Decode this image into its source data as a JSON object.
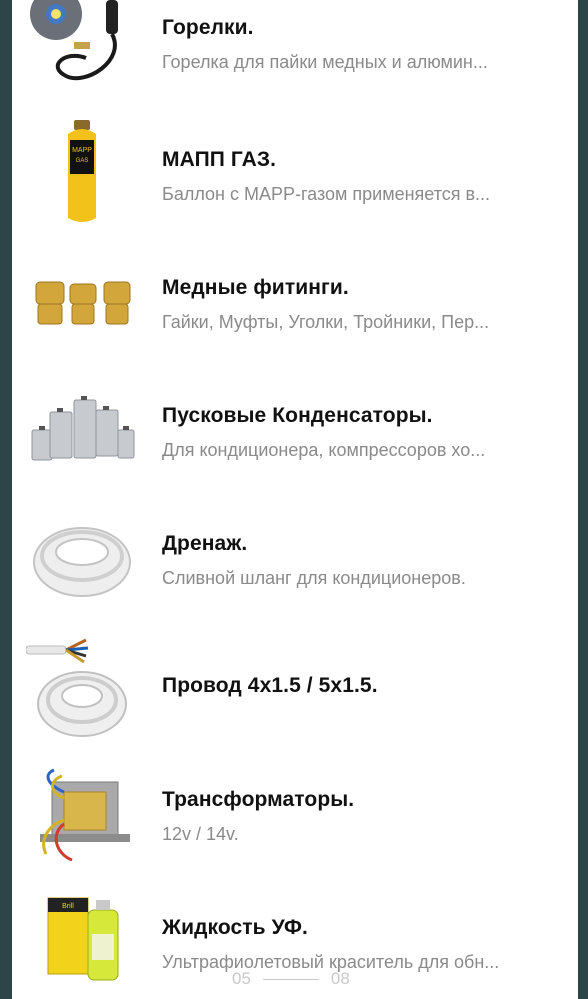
{
  "colors": {
    "frame": "#2b4548",
    "background": "#ffffff",
    "title": "#111111",
    "subtitle": "#8a8a8a"
  },
  "items": [
    {
      "icon": "torch-icon",
      "title": "Горелки.",
      "desc": "Горелка  для пайки медных и алюмин..."
    },
    {
      "icon": "mapp-gas-cylinder-icon",
      "title": "МАПП ГАЗ.",
      "desc": "Баллон с MAPP-газом применяется в..."
    },
    {
      "icon": "copper-fittings-icon",
      "title": "Медные фитинги.",
      "desc": "Гайки, Муфты, Уголки, Тройники,  Пер..."
    },
    {
      "icon": "capacitors-icon",
      "title": "Пусковые Конденсаторы.",
      "desc": "Для кондиционера, компрессоров хо..."
    },
    {
      "icon": "drain-hose-icon",
      "title": "Дренаж.",
      "desc": "Сливной шланг для кондиционеров."
    },
    {
      "icon": "wire-coil-icon",
      "title": "Провод 4x1.5 / 5x1.5.",
      "desc": ""
    },
    {
      "icon": "transformer-icon",
      "title": "Трансформаторы.",
      "desc": "12v / 14v."
    },
    {
      "icon": "uv-dye-bottle-icon",
      "title": "Жидкость УФ.",
      "desc": "Ультрафиолетовый краситель для обн..."
    }
  ],
  "pager": {
    "current": "05",
    "total": "08"
  }
}
